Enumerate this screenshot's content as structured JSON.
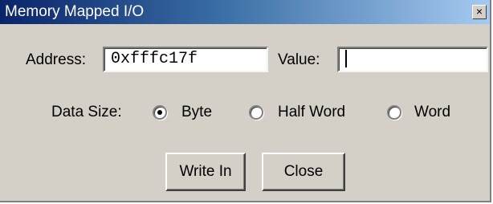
{
  "window": {
    "title": "Memory Mapped I/O",
    "close_glyph": "×"
  },
  "form": {
    "address_label": "Address:",
    "address_value": "0xfffc17f",
    "value_label": "Value:",
    "value_value": "",
    "data_size_label": "Data Size:",
    "options": [
      {
        "label": "Byte",
        "selected": true
      },
      {
        "label": "Half Word",
        "selected": false
      },
      {
        "label": "Word",
        "selected": false
      }
    ]
  },
  "buttons": {
    "write_label": "Write In",
    "close_label": "Close"
  },
  "icons": {
    "close": "close-icon",
    "radio": "radio-icon"
  },
  "colors": {
    "titlebar_start": "#0a246a",
    "titlebar_end": "#a6caf0",
    "face": "#d4d0c8"
  }
}
